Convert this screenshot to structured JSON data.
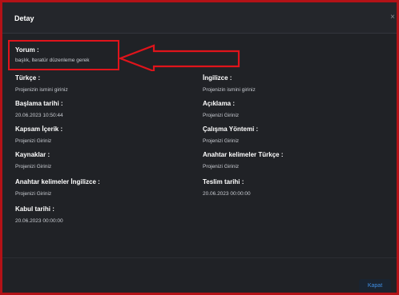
{
  "modal": {
    "title": "Detay",
    "close_glyph": "×"
  },
  "fields": {
    "yorum": {
      "label": "Yorum :",
      "value": "başlık, lteratür düzenleme gerek"
    },
    "turkce": {
      "label": "Türkçe :",
      "value": "Projenizin ismini giriniz"
    },
    "ingilizce": {
      "label": "İngilizce :",
      "value": "Projenizin ismini giriniz"
    },
    "baslama_tarihi": {
      "label": "Başlama tarihi :",
      "value": "20.06.2023 10:50:44"
    },
    "aciklama": {
      "label": "Açıklama :",
      "value": "Projenizi Giriniz"
    },
    "kapsam_icerik": {
      "label": "Kapsam İçerik :",
      "value": "Projenizi Giriniz"
    },
    "calisma_yontemi": {
      "label": "Çalışma Yöntemi :",
      "value": "Projenizi Giriniz"
    },
    "kaynaklar": {
      "label": "Kaynaklar :",
      "value": "Projenizi Giriniz"
    },
    "anahtar_tr": {
      "label": "Anahtar kelimeler Türkçe :",
      "value": "Projenizi Giriniz"
    },
    "anahtar_en": {
      "label": "Anahtar kelimeler İngilizce :",
      "value": "Projenizi Giriniz"
    },
    "teslim_tarihi": {
      "label": "Teslim tarihi :",
      "value": "20.06.2023 00:00:00"
    },
    "kabul_tarihi": {
      "label": "Kabul tarihi :",
      "value": "20.06.2023 00:00:00"
    }
  },
  "footer": {
    "close_label": "Kapat"
  },
  "colors": {
    "background": "#202226",
    "annotation_red": "#e0141b",
    "frame_red": "#b31217",
    "button_text": "#3f8ee3"
  }
}
